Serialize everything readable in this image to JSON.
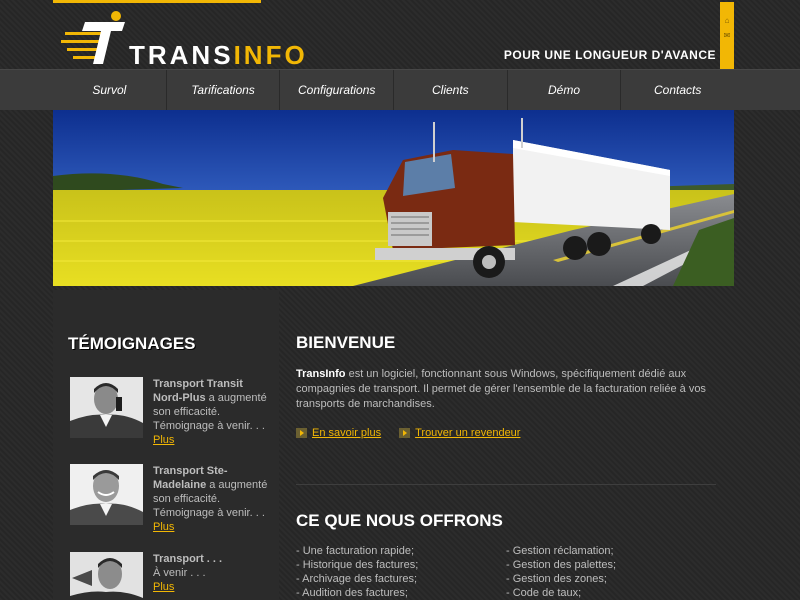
{
  "header": {
    "logo_text_left": "TRANS",
    "logo_text_right": "INFO",
    "tagline": "POUR UNE LONGUEUR D'AVANCE",
    "side_icons": [
      "home-icon",
      "mail-icon"
    ],
    "accent_color": "#f2b705"
  },
  "nav": {
    "items": [
      {
        "label": "Survol"
      },
      {
        "label": "Tarifications"
      },
      {
        "label": "Configurations"
      },
      {
        "label": "Clients"
      },
      {
        "label": "Démo"
      },
      {
        "label": "Contacts"
      }
    ]
  },
  "testimonials": {
    "title": "TÉMOIGNAGES",
    "items": [
      {
        "company": "Transport Transit Nord-Plus",
        "text": " a augmenté son efficacité. Témoignage à venir. . . ",
        "more": "Plus"
      },
      {
        "company": "Transport Ste-Madelaine",
        "text": " a augmenté son efficacité. Témoignage à venir. . . ",
        "more": "Plus"
      },
      {
        "company": "Transport . . .",
        "text": "À venir . . .",
        "more": "Plus"
      }
    ]
  },
  "welcome": {
    "title": "BIENVENUE",
    "brand": "TransInfo",
    "intro": " est un logiciel, fonctionnant sous Windows, spécifiquement dédié aux compagnies de transport. Il permet de gérer l'ensemble de la facturation reliée à vos transports de marchandises.",
    "link1": "En savoir plus",
    "link2": "Trouver un revendeur"
  },
  "offer": {
    "title": "CE QUE NOUS OFFRONS",
    "col1": [
      "- Une facturation rapide;",
      "- Historique des factures;",
      "- Archivage des factures;",
      "- Audition des factures;"
    ],
    "col2": [
      "- Gestion réclamation;",
      "- Gestion des palettes;",
      "- Gestion des zones;",
      "- Code de taux;"
    ]
  }
}
